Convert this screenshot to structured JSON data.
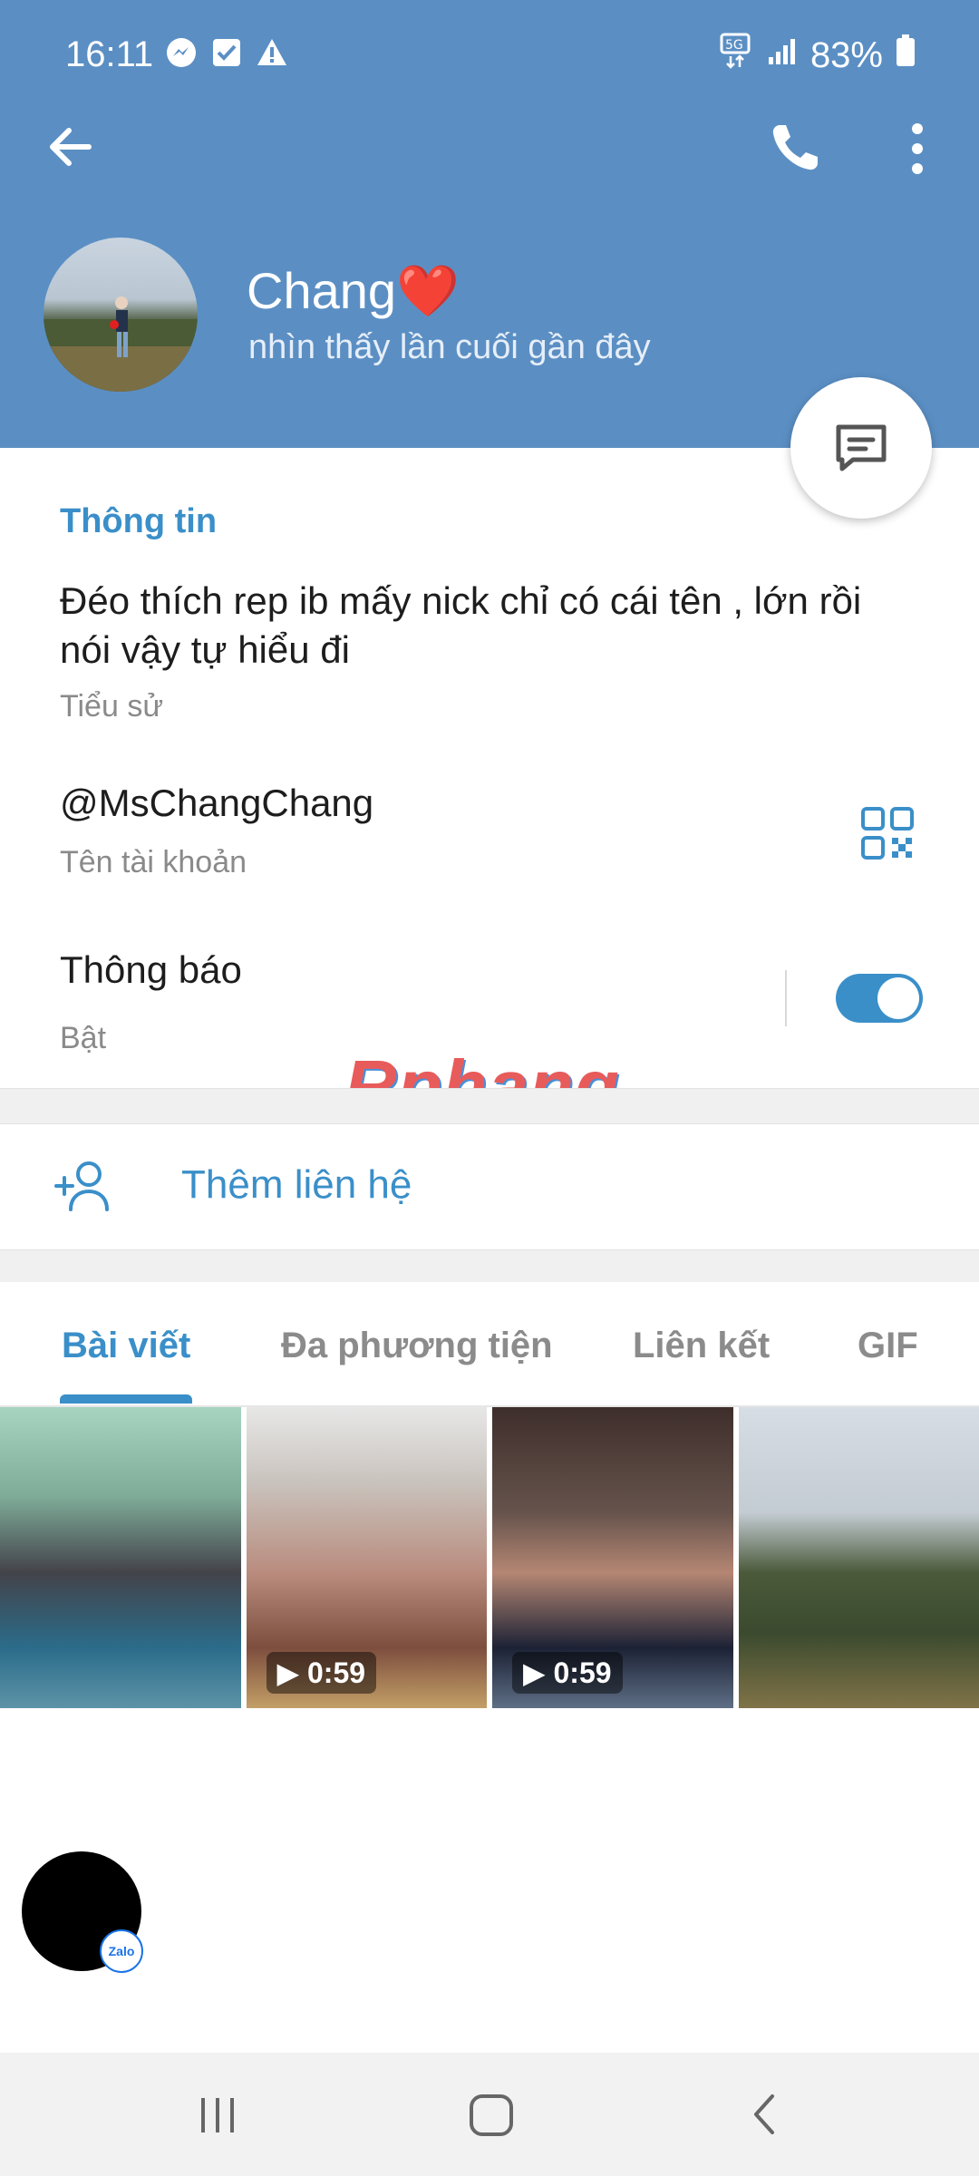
{
  "status_bar": {
    "time": "16:11",
    "battery": "83%",
    "left_icons": [
      "messenger-icon",
      "check-square-icon",
      "warning-icon"
    ],
    "right_icons": [
      "5g-icon",
      "signal-icon",
      "battery-icon"
    ]
  },
  "header": {
    "background": "#5b8fc4",
    "name": "Chang❤️",
    "last_seen": "nhìn thấy lần cuối gần đây"
  },
  "info": {
    "section_title": "Thông tin",
    "bio": "Đéo thích rep ib mấy nick chỉ có cái tên , lớn rồi nói vậy tự hiểu đi",
    "bio_label": "Tiểu sử",
    "username": "@MsChangChang",
    "username_label": "Tên tài khoản",
    "notifications_title": "Thông báo",
    "notifications_state": "Bật",
    "notifications_enabled": true
  },
  "watermark": "Rphang",
  "add_contact": {
    "label": "Thêm liên hệ"
  },
  "tabs": [
    {
      "label": "Bài viết",
      "active": true
    },
    {
      "label": "Đa phương tiện",
      "active": false
    },
    {
      "label": "Liên kết",
      "active": false
    },
    {
      "label": "GIF",
      "active": false
    }
  ],
  "media": [
    {
      "duration": ""
    },
    {
      "duration": "▶ 0:59"
    },
    {
      "duration": "▶ 0:59"
    },
    {
      "duration": ""
    }
  ],
  "floating": {
    "badge": "Zalo"
  },
  "accent_color": "#3a8fc9"
}
